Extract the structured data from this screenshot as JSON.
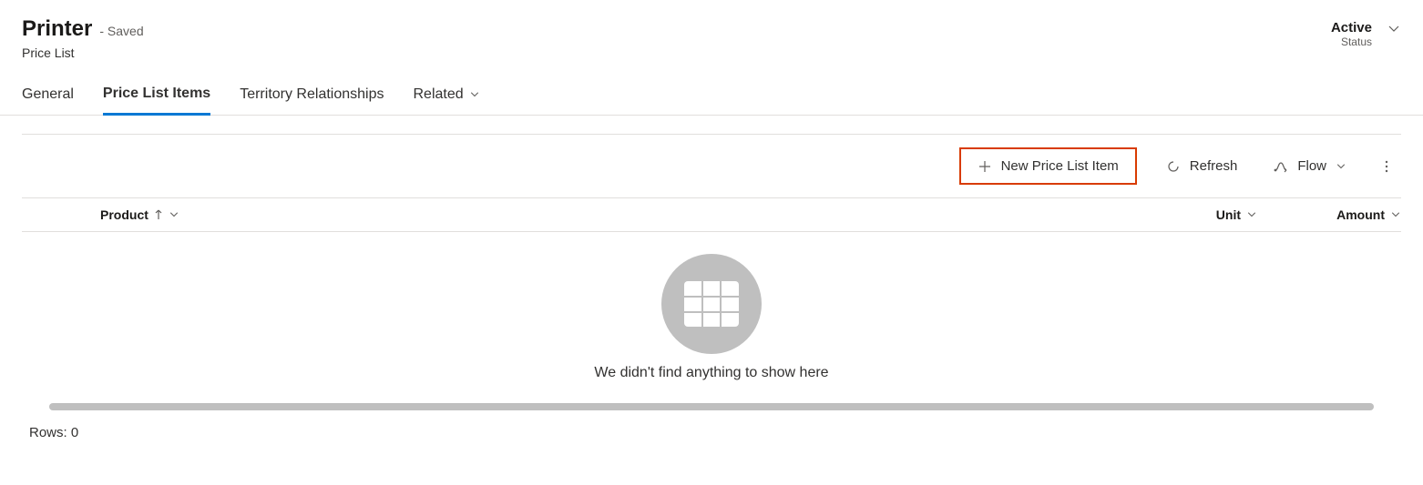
{
  "header": {
    "title": "Printer",
    "saved_suffix": "- Saved",
    "entity_type": "Price List"
  },
  "status": {
    "value": "Active",
    "label": "Status"
  },
  "tabs": {
    "general": "General",
    "price_list_items": "Price List Items",
    "territory": "Territory Relationships",
    "related": "Related"
  },
  "toolbar": {
    "new_item": "New Price List Item",
    "refresh": "Refresh",
    "flow": "Flow"
  },
  "columns": {
    "product": "Product",
    "unit": "Unit",
    "amount": "Amount"
  },
  "empty_message": "We didn't find anything to show here",
  "row_count": "Rows: 0"
}
